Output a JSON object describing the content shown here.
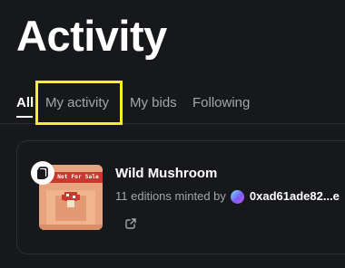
{
  "page": {
    "title": "Activity"
  },
  "tabs": [
    {
      "label": "All",
      "active": true
    },
    {
      "label": "My activity",
      "active": false
    },
    {
      "label": "My bids",
      "active": false
    },
    {
      "label": "Following",
      "active": false
    }
  ],
  "activity": {
    "item_name": "Wild Mushroom",
    "thumbnail_caption": "Not For Sale",
    "minted_text": "11 editions minted by",
    "address": "0xad61ade82...e"
  },
  "colors": {
    "background": "#17181b",
    "highlight": "#f7f21f",
    "muted_text": "#a4a6ab"
  }
}
